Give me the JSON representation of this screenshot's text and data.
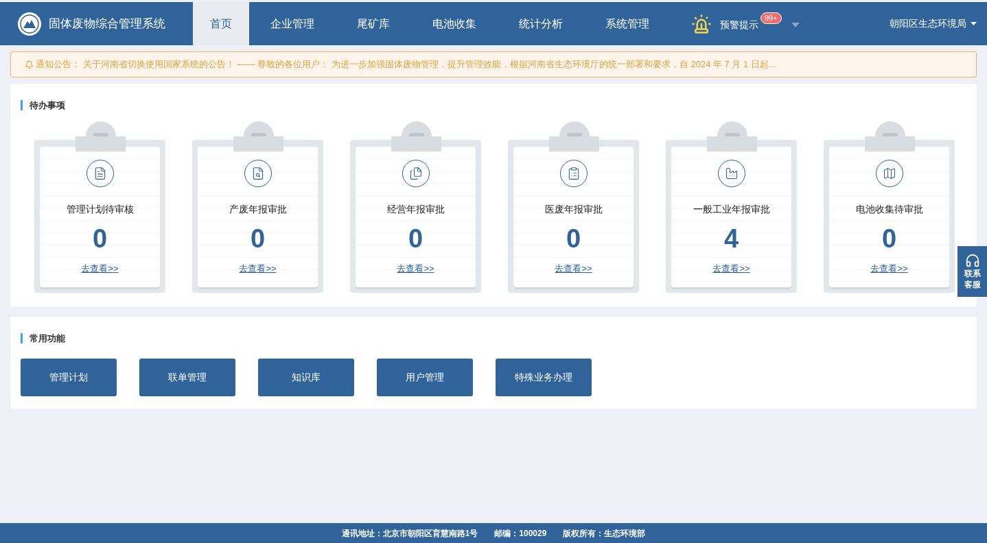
{
  "header": {
    "title": "固体废物综合管理系统",
    "nav": [
      {
        "label": "首页",
        "selected": true
      },
      {
        "label": "企业管理",
        "selected": false
      },
      {
        "label": "尾矿库",
        "selected": false
      },
      {
        "label": "电池收集",
        "selected": false
      },
      {
        "label": "统计分析",
        "selected": false
      },
      {
        "label": "系统管理",
        "selected": false
      }
    ],
    "alert": {
      "label": "预警提示",
      "badge": "99+"
    },
    "user": "朝阳区生态环境局"
  },
  "notice": {
    "label": "通知公告：",
    "text": "关于河南省切换使用国家系统的公告！ —— 尊敬的各位用户： 为进一步加强固体废物管理，提升管理效能，根据河南省生态环境厅的统一部署和要求，自 2024 年 7 月 1 日起..."
  },
  "todo": {
    "title": "待办事项",
    "cards": [
      {
        "label": "管理计划待审核",
        "count": "0",
        "link": "去查看>>"
      },
      {
        "label": "产废年报审批",
        "count": "0",
        "link": "去查看>>"
      },
      {
        "label": "经营年报审批",
        "count": "0",
        "link": "去查看>>"
      },
      {
        "label": "医废年报审批",
        "count": "0",
        "link": "去查看>>"
      },
      {
        "label": "一般工业年报审批",
        "count": "4",
        "link": "去查看>>"
      },
      {
        "label": "电池收集待审批",
        "count": "0",
        "link": "去查看>>"
      }
    ]
  },
  "functions": {
    "title": "常用功能",
    "buttons": [
      "管理计划",
      "联单管理",
      "知识库",
      "用户管理",
      "特殊业务办理"
    ]
  },
  "contact": "联系客服",
  "footer": {
    "address": "通讯地址：北京市朝阳区育慧南路1号",
    "postcode": "邮编：100029",
    "copyright": "版权所有：生态环境部"
  }
}
